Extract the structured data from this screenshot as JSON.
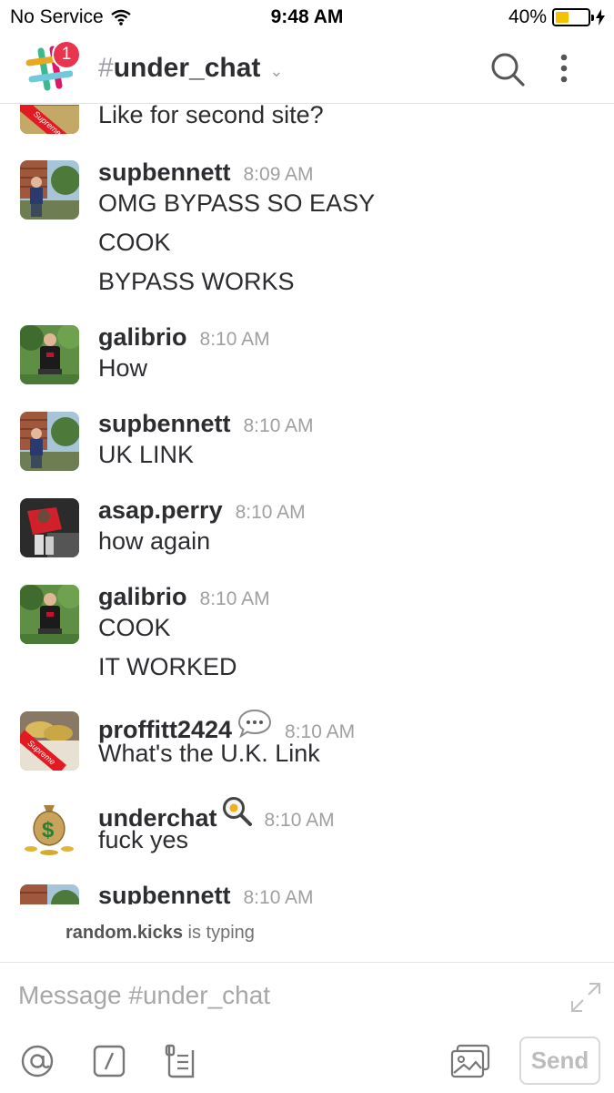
{
  "status_bar": {
    "carrier": "No Service",
    "time": "9:48 AM",
    "battery": "40%",
    "battery_level": 0.4
  },
  "header": {
    "badge_count": "1",
    "channel_hash": "#",
    "channel_name": "under_chat",
    "chevron": "⌄"
  },
  "messages": [
    {
      "lines": [
        "Like for second site?"
      ]
    },
    {
      "user": "supbennett",
      "time": "8:09 AM",
      "lines": [
        "OMG BYPASS SO EASY",
        "COOK",
        "BYPASS WORKS"
      ]
    },
    {
      "user": "galibrio",
      "time": "8:10 AM",
      "lines": [
        "How"
      ]
    },
    {
      "user": "supbennett",
      "time": "8:10 AM",
      "lines": [
        "UK LINK"
      ]
    },
    {
      "user": "asap.perry",
      "time": "8:10 AM",
      "lines": [
        "how again"
      ]
    },
    {
      "user": "galibrio",
      "time": "8:10 AM",
      "lines": [
        "COOK",
        "IT WORKED"
      ]
    },
    {
      "user": "proffitt2424",
      "time": "8:10 AM",
      "lines": [
        "What's the U.K. Link"
      ],
      "user_icon": "speech-bubble-icon"
    },
    {
      "user": "underchat",
      "time": "8:10 AM",
      "lines": [
        "fuck yes"
      ],
      "user_icon": "frying-pan-egg-icon"
    },
    {
      "user": "supbennett",
      "time": "8:10 AM",
      "lines": []
    }
  ],
  "typing": {
    "user": "random.kicks",
    "text": " is typing"
  },
  "composer": {
    "placeholder": "Message #under_chat",
    "send_label": "Send"
  },
  "avatar_labels": {
    "supreme": "Supreme"
  },
  "colors": {
    "badge": "#e8344e",
    "text": "#2c2d30",
    "timestamp": "#a0a0a2",
    "battery": "#f4c300"
  }
}
